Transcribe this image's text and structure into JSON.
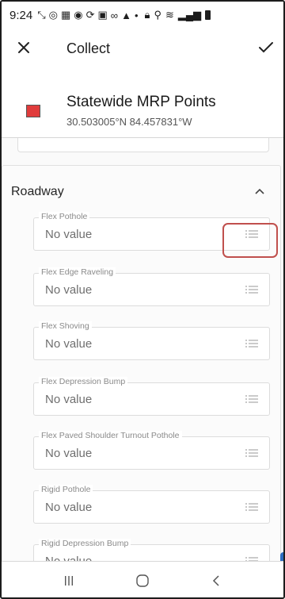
{
  "status_bar": {
    "time": "9:24"
  },
  "header": {
    "title": "Collect"
  },
  "layer": {
    "name": "Statewide MRP Points",
    "coordinates": "30.503005°N 84.457831°W",
    "color": "#e03c3c"
  },
  "section": {
    "title": "Roadway",
    "expanded": true
  },
  "fields": [
    {
      "label": "Flex Pothole",
      "value": "No value"
    },
    {
      "label": "Flex Edge Raveling",
      "value": "No value"
    },
    {
      "label": "Flex Shoving",
      "value": "No value"
    },
    {
      "label": "Flex Depression Bump",
      "value": "No value"
    },
    {
      "label": "Flex Paved Shoulder Turnout Pothole",
      "value": "No value"
    },
    {
      "label": "Rigid Pothole",
      "value": "No value"
    },
    {
      "label": "Rigid Depression Bump",
      "value": "No value"
    }
  ],
  "colors": {
    "highlight": "#c0504d",
    "swatch": "#e03c3c"
  }
}
